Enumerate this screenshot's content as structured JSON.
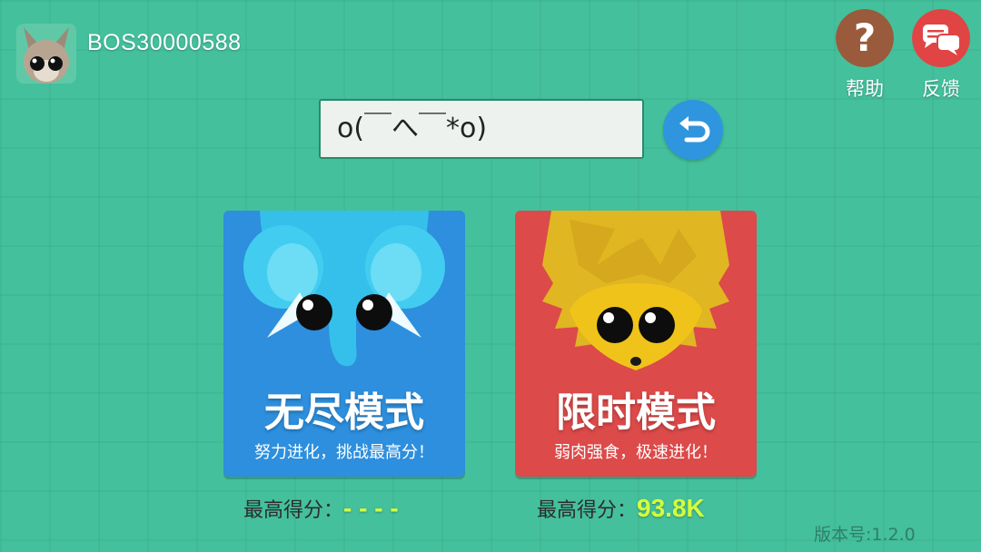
{
  "player": {
    "name": "BOS30000588",
    "avatar_icon": "flying-squirrel-avatar-icon"
  },
  "top_buttons": {
    "help": {
      "label": "帮助",
      "icon": "question-mark-icon",
      "color": "#9a5a3c"
    },
    "feedback": {
      "label": "反馈",
      "icon": "chat-bubbles-icon",
      "color": "#e04444"
    }
  },
  "name_input": {
    "value": "o(￣へ￣*o)"
  },
  "undo_button": {
    "icon": "undo-arrow-icon",
    "color": "#2e95de"
  },
  "modes": [
    {
      "title": "无尽模式",
      "subtitle": "努力进化，挑战最高分！",
      "icon": "elephant-icon",
      "color": "#2d8fdd"
    },
    {
      "title": "限时模式",
      "subtitle": "弱肉强食，极速进化！",
      "icon": "hedgehog-icon",
      "color": "#dc4a49"
    }
  ],
  "scores": [
    {
      "label": "最高得分：",
      "value": "- - - -"
    },
    {
      "label": "最高得分：",
      "value": "93.8K"
    }
  ],
  "version": "版本号:1.2.0"
}
